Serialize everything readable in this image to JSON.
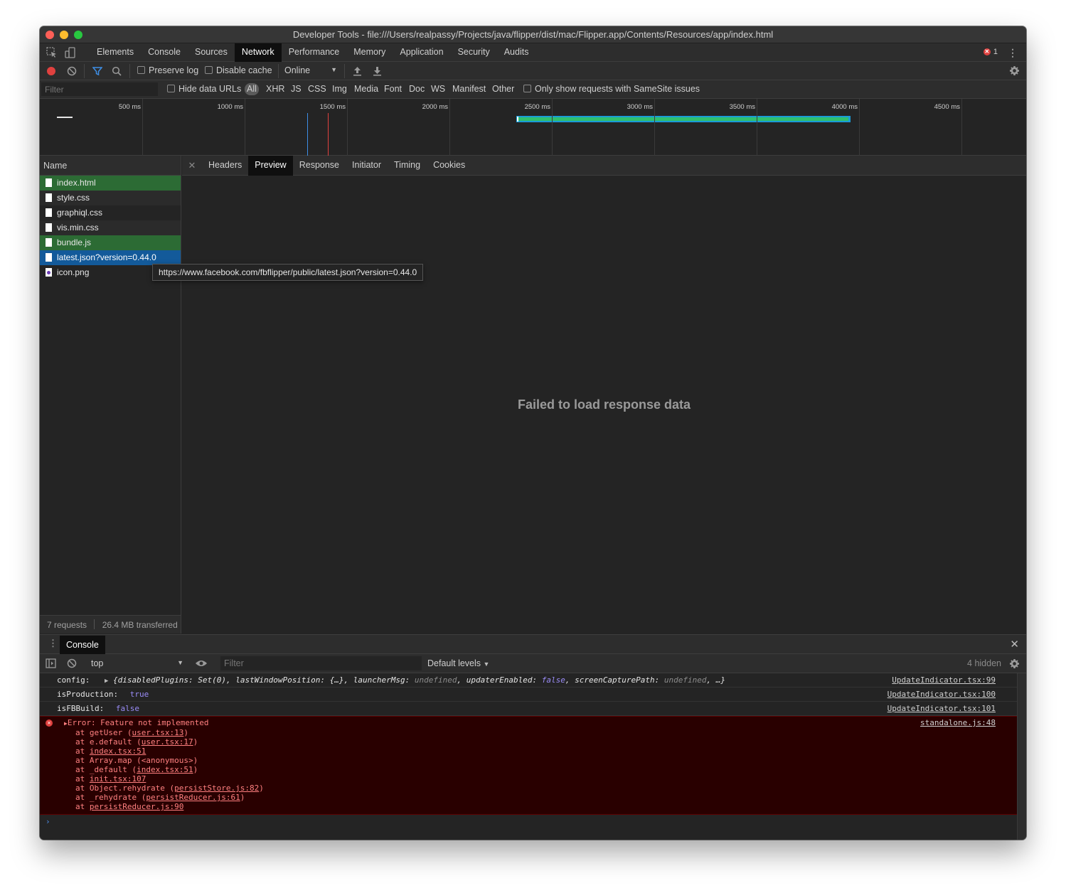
{
  "window": {
    "title": "Developer Tools - file:///Users/realpassy/Projects/java/flipper/dist/mac/Flipper.app/Contents/Resources/app/index.html"
  },
  "main_tabs": [
    {
      "label": "Elements"
    },
    {
      "label": "Console"
    },
    {
      "label": "Sources"
    },
    {
      "label": "Network",
      "active": true
    },
    {
      "label": "Performance"
    },
    {
      "label": "Memory"
    },
    {
      "label": "Application"
    },
    {
      "label": "Security"
    },
    {
      "label": "Audits"
    }
  ],
  "error_count": "1",
  "network_toolbar": {
    "preserve_log": "Preserve log",
    "disable_cache": "Disable cache",
    "throttle": "Online"
  },
  "filter_bar": {
    "placeholder": "Filter",
    "hide_data_urls": "Hide data URLs",
    "types": [
      "All",
      "XHR",
      "JS",
      "CSS",
      "Img",
      "Media",
      "Font",
      "Doc",
      "WS",
      "Manifest",
      "Other"
    ],
    "active_type": "All",
    "samesite": "Only show requests with SameSite issues"
  },
  "overview": {
    "ticks": [
      "500 ms",
      "1000 ms",
      "1500 ms",
      "2000 ms",
      "2500 ms",
      "3000 ms",
      "3500 ms",
      "4000 ms",
      "4500 ms"
    ]
  },
  "requests": {
    "header": "Name",
    "items": [
      {
        "name": "index.html",
        "state": "green"
      },
      {
        "name": "style.css",
        "state": "alt"
      },
      {
        "name": "graphiql.css",
        "state": ""
      },
      {
        "name": "vis.min.css",
        "state": "alt"
      },
      {
        "name": "bundle.js",
        "state": "green"
      },
      {
        "name": "latest.json?version=0.44.0",
        "state": "blue"
      },
      {
        "name": "icon.png",
        "state": ""
      }
    ],
    "summary_requests": "7 requests",
    "summary_transferred": "26.4 MB transferred"
  },
  "tooltip": "https://www.facebook.com/fbflipper/public/latest.json?version=0.44.0",
  "detail": {
    "tabs": [
      "Headers",
      "Preview",
      "Response",
      "Initiator",
      "Timing",
      "Cookies"
    ],
    "active": "Preview",
    "message": "Failed to load response data"
  },
  "drawer": {
    "tab": "Console",
    "context": "top",
    "filter_placeholder": "Filter",
    "levels": "Default levels",
    "hidden": "4 hidden"
  },
  "console": {
    "config_label": "config:",
    "config_src": "UpdateIndicator.tsx:99",
    "isProduction_label": "isProduction:",
    "isProduction_value": "true",
    "isProduction_src": "UpdateIndicator.tsx:100",
    "isFBBuild_label": "isFBBuild:",
    "isFBBuild_value": "false",
    "isFBBuild_src": "UpdateIndicator.tsx:101",
    "error": {
      "message": "Error: Feature not implemented",
      "src": "standalone.js:48",
      "stack": [
        {
          "pre": "at getUser (",
          "link": "user.tsx:13",
          "post": ")"
        },
        {
          "pre": "at e.default (",
          "link": "user.tsx:17",
          "post": ")"
        },
        {
          "pre": "at ",
          "link": "index.tsx:51",
          "post": ""
        },
        {
          "pre": "at Array.map (<anonymous>)",
          "link": "",
          "post": ""
        },
        {
          "pre": "at _default (",
          "link": "index.tsx:51",
          "post": ")"
        },
        {
          "pre": "at ",
          "link": "init.tsx:107",
          "post": ""
        },
        {
          "pre": "at Object.rehydrate (",
          "link": "persistStore.js:82",
          "post": ")"
        },
        {
          "pre": "at _rehydrate (",
          "link": "persistReducer.js:61",
          "post": ")"
        },
        {
          "pre": "at ",
          "link": "persistReducer.js:90",
          "post": ""
        }
      ]
    }
  }
}
